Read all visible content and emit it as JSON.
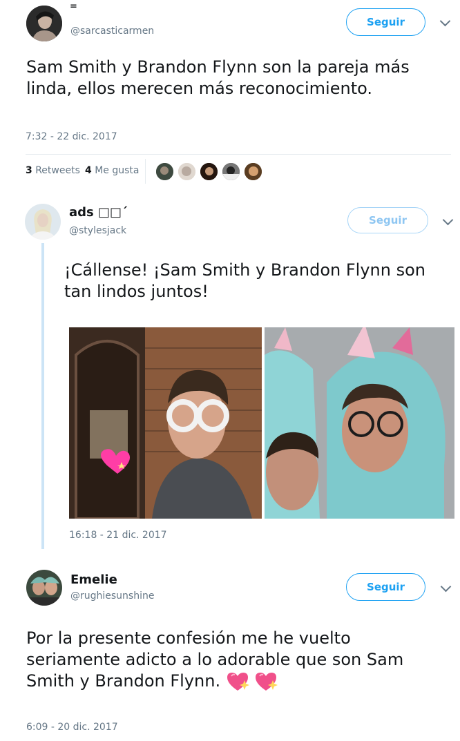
{
  "tweet1": {
    "name": "=",
    "handle": "@sarcasticarmen",
    "follow_label": "Seguir",
    "text": "Sam Smith y Brandon Flynn son la pareja más linda, ellos merecen más reconocimiento.",
    "timestamp": "7:32 - 22 dic. 2017",
    "retweets_count": "3",
    "retweets_label": "Retweets",
    "likes_count": "4",
    "likes_label": "Me gusta"
  },
  "tweet2": {
    "name": "ads □□ˊ",
    "handle": "@stylesjack",
    "follow_label": "Seguir",
    "text": "¡Cállense! ¡Sam Smith y Brandon Flynn son tan lindos juntos!",
    "timestamp": "16:18 - 21 dic. 2017",
    "photo_count": 2
  },
  "tweet3": {
    "name": "Emelie",
    "handle": "@rughiesunshine",
    "follow_label": "Seguir",
    "text": "Por la presente confesión me he vuelto seriamente adicto a lo adorable que son Sam Smith y Brandon Flynn.",
    "emoji": "sparkling-heart-icon",
    "emoji_count": 2,
    "timestamp": "6:09 - 20 dic. 2017"
  },
  "colors": {
    "accent": "#1da1f2",
    "muted_text": "#657786",
    "divider": "#e6ecf0",
    "thread_line": "#cce4f6"
  }
}
